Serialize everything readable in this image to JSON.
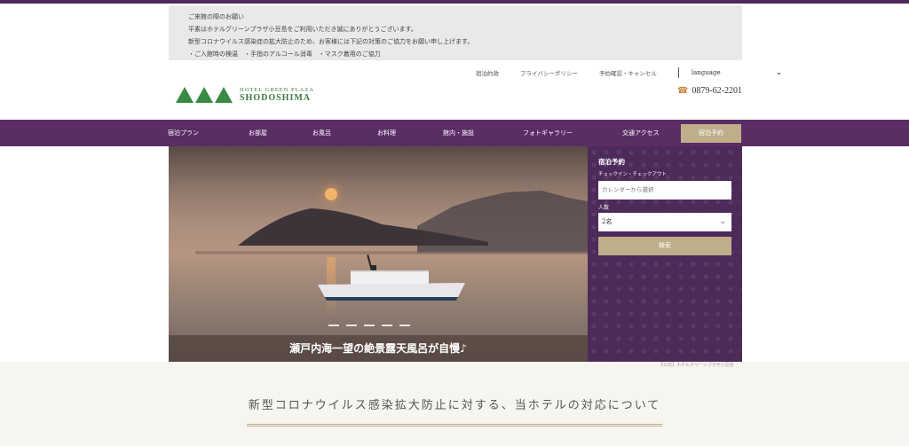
{
  "notice": {
    "lines": [
      "ご来館の際のお願い",
      "平素はホテルグリーンプラザ小豆島をご利用いただき誠にありがとうございます。",
      "新型コロナウイルス感染症の拡大防止のため、お客様には下記の対策のご協力をお願い申し上げます。",
      "・ご入館時の検温　・手指のアルコール消毒　・マスク着用のご協力"
    ]
  },
  "util_nav": {
    "items": [
      "宿泊約款",
      "プライバシーポリシー",
      "予約確認・キャンセル"
    ],
    "language": "language"
  },
  "logo": {
    "line1": "HOTEL GREEN PLAZA",
    "line2": "SHODOSHIMA"
  },
  "phone": "0879-62-2201",
  "main_nav": {
    "items": [
      "宿泊プラン",
      "お部屋",
      "お風呂",
      "お料理",
      "館内・施設",
      "フォトギャラリー",
      "交通アクセス"
    ],
    "reserve": "宿泊予約"
  },
  "hero": {
    "caption": "瀬戸内海一望の絶景露天風呂が自慢♪",
    "slide_count": 5
  },
  "booking": {
    "title": "宿泊予約",
    "checkin_label": "チェックイン・チェックアウト",
    "date_placeholder": "カレンダーから選択",
    "guests_label": "人数",
    "guests_value": "2名",
    "search": "検索"
  },
  "credit": "【公式】ホテルグリーンプラザ小豆島",
  "section_title": "新型コロナウイルス感染拡大防止に対する、当ホテルの対応について",
  "colors": {
    "purple": "#5a2d65",
    "gold": "#bfae8a",
    "green": "#3a8a45"
  }
}
